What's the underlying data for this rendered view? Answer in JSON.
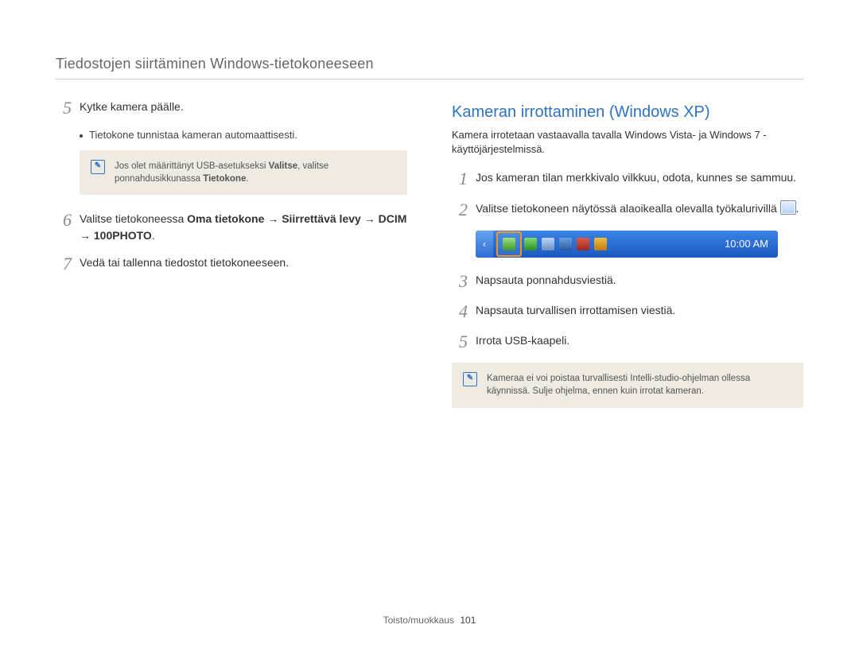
{
  "page_title": "Tiedostojen siirtäminen Windows-tietokoneeseen",
  "left": {
    "step5": {
      "num": "5",
      "text": "Kytke kamera päälle."
    },
    "step5_bullet": "Tietokone tunnistaa kameran automaattisesti.",
    "note1_a": "Jos olet määrittänyt USB-asetukseksi ",
    "note1_b": "Valitse",
    "note1_c": ", valitse ponnahdusikkunassa ",
    "note1_d": "Tietokone",
    "note1_e": ".",
    "step6": {
      "num": "6",
      "pre": "Valitse tietokoneessa ",
      "b1": "Oma tietokone",
      "arrow1": " → ",
      "b2": "Siirrettävä levy",
      "arrow2": " → ",
      "b3": "DCIM",
      "arrow3": " → ",
      "b4": "100PHOTO",
      "post": "."
    },
    "step7": {
      "num": "7",
      "text": "Vedä tai tallenna tiedostot tietokoneeseen."
    }
  },
  "right": {
    "title": "Kameran irrottaminen (Windows XP)",
    "subtitle": "Kamera irrotetaan vastaavalla tavalla Windows Vista- ja Windows 7 -käyttöjärjestelmissä.",
    "step1": {
      "num": "1",
      "text": "Jos kameran tilan merkkivalo vilkkuu, odota, kunnes se sammuu."
    },
    "step2": {
      "num": "2",
      "pre": "Valitse tietokoneen näytössä alaoikealla olevalla työkalurivillä ",
      "post": "."
    },
    "taskbar_clock": "10:00 AM",
    "step3": {
      "num": "3",
      "text": "Napsauta ponnahdusviestiä."
    },
    "step4": {
      "num": "4",
      "text": "Napsauta turvallisen irrottamisen viestiä."
    },
    "step5": {
      "num": "5",
      "text": "Irrota USB-kaapeli."
    },
    "note2": "Kameraa ei voi poistaa turvallisesti Intelli-studio-ohjelman ollessa käynnissä. Sulje ohjelma, ennen kuin irrotat kameran."
  },
  "footer": {
    "section": "Toisto/muokkaus",
    "page": "101"
  }
}
